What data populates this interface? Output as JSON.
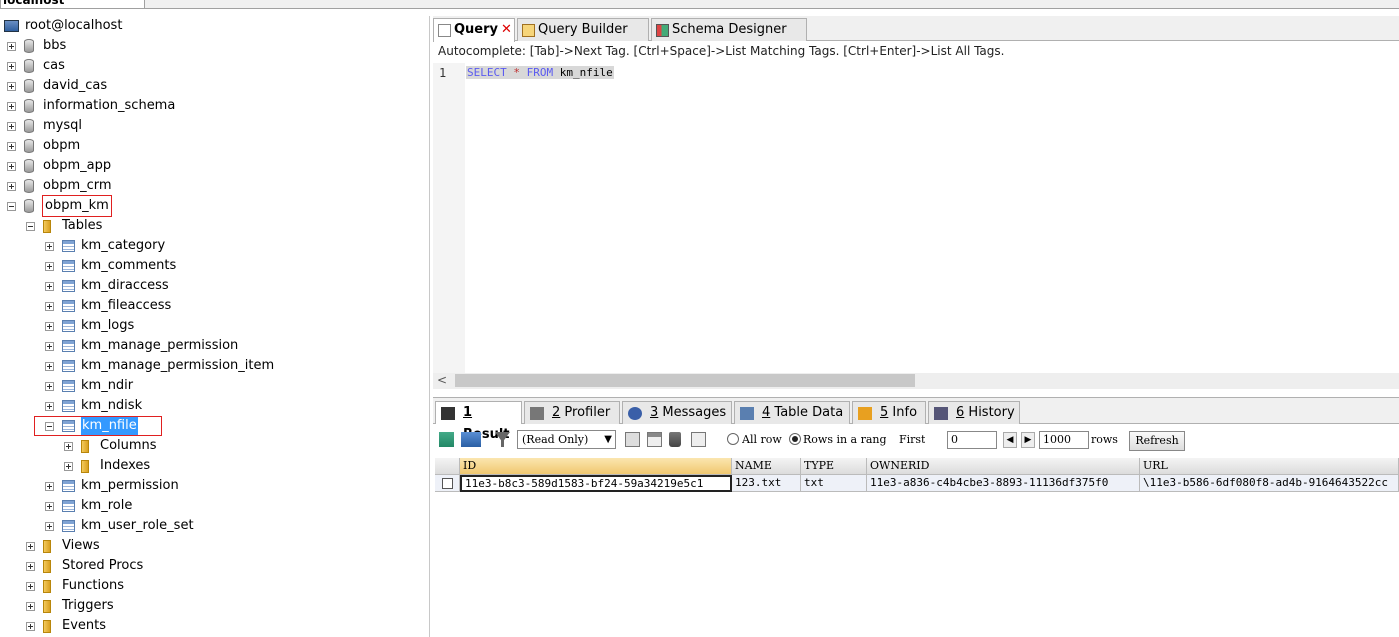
{
  "window": {
    "tab_title": "localhost"
  },
  "tree": {
    "connection": "root@localhost",
    "databases": [
      "bbs",
      "cas",
      "david_cas",
      "information_schema",
      "mysql",
      "obpm",
      "obpm_app",
      "obpm_crm",
      "obpm_km"
    ],
    "tables_folder": "Tables",
    "tables": [
      "km_category",
      "km_comments",
      "km_diraccess",
      "km_fileaccess",
      "km_logs",
      "km_manage_permission",
      "km_manage_permission_item",
      "km_ndir",
      "km_ndisk",
      "km_nfile",
      "km_permission",
      "km_role",
      "km_user_role_set"
    ],
    "table_children": [
      "Columns",
      "Indexes"
    ],
    "other_folders": [
      "Views",
      "Stored Procs",
      "Functions",
      "Triggers",
      "Events"
    ]
  },
  "editor": {
    "tabs": [
      "Query",
      "Query Builder",
      "Schema Designer"
    ],
    "autocomplete_hint": "Autocomplete: [Tab]->Next Tag. [Ctrl+Space]->List Matching Tags. [Ctrl+Enter]->List All Tags.",
    "line_number": "1",
    "sql": {
      "select": "SELECT",
      "star": "*",
      "from": "FROM",
      "table": "km_nfile"
    }
  },
  "results": {
    "tabs": [
      {
        "num": "1",
        "label": "Result"
      },
      {
        "num": "2",
        "label": "Profiler"
      },
      {
        "num": "3",
        "label": "Messages"
      },
      {
        "num": "4",
        "label": "Table Data"
      },
      {
        "num": "5",
        "label": "Info"
      },
      {
        "num": "6",
        "label": "History"
      }
    ],
    "toolbar": {
      "mode": "(Read Only)",
      "all_rows_label": "All row",
      "rows_in_range_label": "Rows in a rang",
      "first_label": "First",
      "first_value": "0",
      "count_value": "1000",
      "rows_label": "rows",
      "refresh_label": "Refresh"
    },
    "columns": [
      "ID",
      "NAME",
      "TYPE",
      "OWNERID",
      "URL"
    ],
    "rows": [
      [
        "11e3-b8c3-589d1583-bf24-59a34219e5c1",
        "123.txt",
        "txt",
        "11e3-a836-c4b4cbe3-8893-11136df375f0",
        "\\11e3-b586-6df080f8-ad4b-9164643522cc"
      ]
    ]
  },
  "colors": {
    "selection": "#3399ff",
    "highlight_box": "#e02020",
    "keyword": "#5a5af0"
  }
}
